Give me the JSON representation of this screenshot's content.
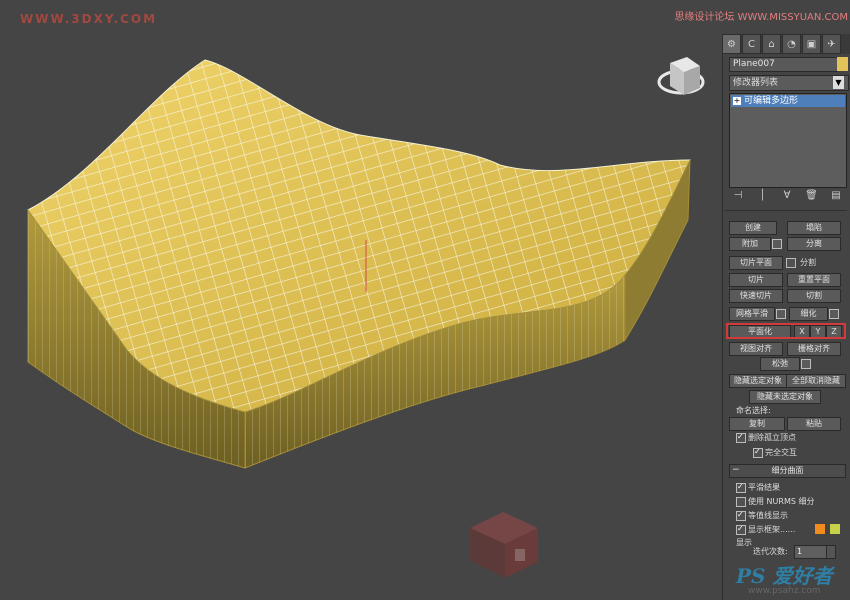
{
  "watermarks": {
    "top_left": "WWW.3DXY.COM",
    "top_right": "思缘设计论坛 WWW.MISSYUAN.COM",
    "bottom_right": "PS 爱好者",
    "bottom_sub": "www.psahz.com"
  },
  "panel": {
    "tabs": [
      "⚙",
      "C",
      "⌂",
      "◔",
      "▣",
      "✈"
    ],
    "object_name": "Plane007",
    "modifier_list": "修改器列表",
    "stack_item": "可编辑多边形",
    "stack_plus": "+",
    "toolbar_icons": [
      "pin-icon",
      "show-icon",
      "funnel-icon",
      "trash-icon",
      "config-icon"
    ],
    "buttons": {
      "create": "创建",
      "collapse": "塌陷",
      "attach": "附加",
      "detach": "分离",
      "slice_plane": "切片平面",
      "split": "分割",
      "slice": "切片",
      "reset_plane": "重置平面",
      "quickslice": "快速切片",
      "cut": "切割",
      "meshsmooth": "网格平滑",
      "tessellate": "细化",
      "make_planar": "平面化",
      "x": "X",
      "y": "Y",
      "z": "Z",
      "view_align": "视图对齐",
      "grid_align": "栅格对齐",
      "relax": "松弛",
      "hide_selected": "隐藏选定对象",
      "unhide_all": "全部取消隐藏",
      "hide_unselected": "隐藏未选定对象",
      "named_selections": "命名选择:",
      "copy": "复制",
      "paste": "粘贴",
      "delete_isolated": "删除孤立顶点",
      "full_interactivity": "完全交互"
    },
    "subdivision": {
      "title": "细分曲面",
      "smooth_result": "平滑结果",
      "use_nurms": "使用 NURMS 细分",
      "isoline_display": "等值线显示",
      "show_cage": "显示框架......",
      "display": "显示",
      "iterations_label": "迭代次数:",
      "iterations_value": "1",
      "cage_color_1": "#f08c1e",
      "cage_color_2": "#c7d14a"
    },
    "accent_colors": {
      "object_color": "#e3c35a",
      "stack_highlight": "#4e7fbb",
      "red_box": "#d23b3b"
    }
  }
}
